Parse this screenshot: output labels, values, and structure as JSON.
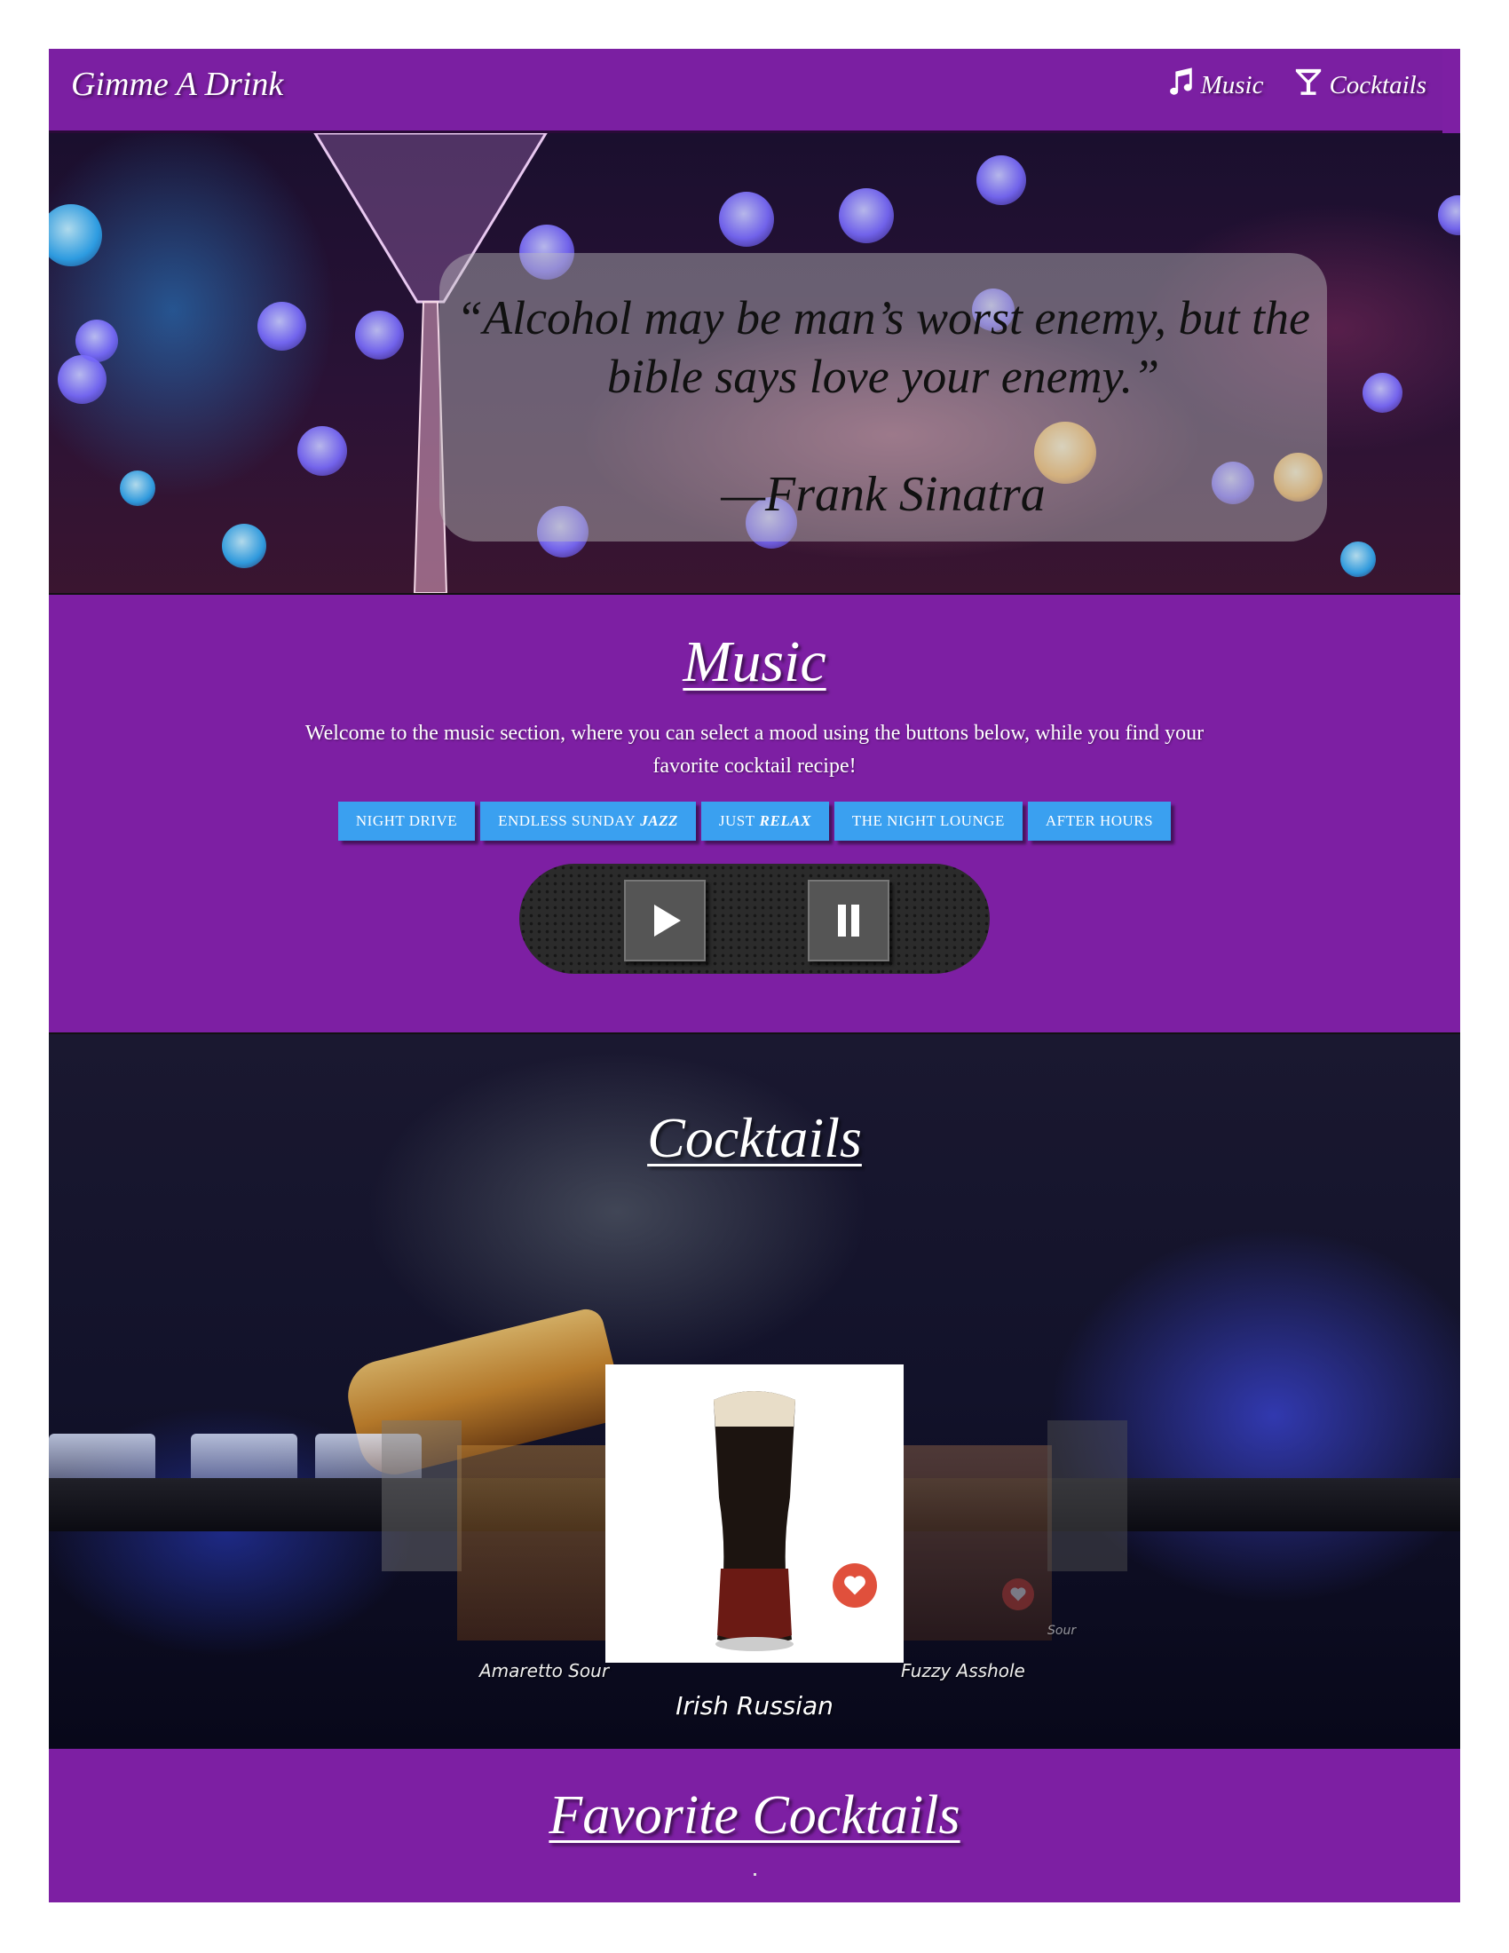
{
  "navbar": {
    "brand": "Gimme A Drink",
    "links": [
      {
        "label": "Music",
        "icon": "music-note-icon"
      },
      {
        "label": "Cocktails",
        "icon": "cocktail-glass-icon"
      }
    ]
  },
  "hero": {
    "quote": "“Alcohol may be man’s worst enemy, but the bible says love your enemy.”",
    "author": "—Frank Sinatra"
  },
  "music": {
    "title": "Music",
    "description": "Welcome to the music section, where you can select a mood using the buttons below, while you find your favorite cocktail recipe!",
    "moods": [
      {
        "label": "NIGHT DRIVE",
        "emphasis": ""
      },
      {
        "label": "ENDLESS SUNDAY",
        "emphasis": "JAZZ"
      },
      {
        "label": "JUST",
        "emphasis": "RELAX"
      },
      {
        "label": "THE NIGHT LOUNGE",
        "emphasis": ""
      },
      {
        "label": "AFTER HOURS",
        "emphasis": ""
      }
    ],
    "player": {
      "play_icon": "play-icon",
      "pause_icon": "pause-icon"
    }
  },
  "cocktails": {
    "title": "Cocktails",
    "carousel": {
      "active": "Irish Russian",
      "left": "Amaretto Sour",
      "right": "Fuzzy Asshole",
      "far_right": "Sour"
    }
  },
  "favorites": {
    "title": "Favorite Cocktails"
  },
  "colors": {
    "accent_purple": "#7d1fa3",
    "mood_button_blue": "#3aa0f0",
    "heart_red": "#e0503c"
  }
}
